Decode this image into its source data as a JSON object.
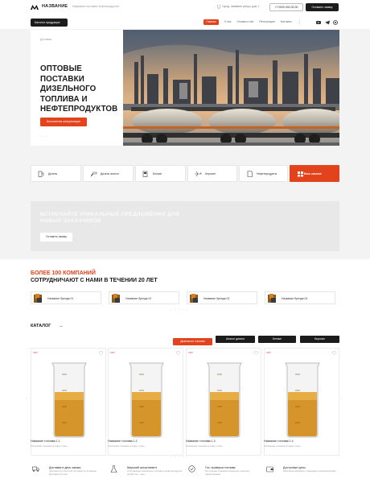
{
  "header": {
    "logo_text": "НАЗВАНИЕ",
    "tagline": "Надежная поставка нефтепродуктов",
    "city": "Город, название улицы, дом 1",
    "phone": "+7 0000 000-00-00",
    "order_btn": "Оставить заявку",
    "catalog_btn": "Каталог продукции",
    "nav": [
      "Главная",
      "О нас",
      "Отзывы о нас",
      "Контакты"
    ],
    "nav_extra": "Регистрация",
    "social": [
      "youtube-icon",
      "telegram-icon",
      "whatsapp-icon"
    ]
  },
  "hero": {
    "breadcrumb": "Доставка",
    "title": "ОПТОВЫЕ ПОСТАВКИ ДИЗЕЛЬНОГО ТОПЛИВА И НЕФТЕПРОДУКТОВ",
    "button": "Бесплатная консультация"
  },
  "categories": [
    {
      "label": "Дизель",
      "icon": "fuel-pump-icon"
    },
    {
      "label": "Дизель аналог",
      "icon": "fuel-nozzle-icon"
    },
    {
      "label": "Бензин",
      "icon": "gas-station-icon"
    },
    {
      "label": "Керосин",
      "icon": "plane-icon"
    },
    {
      "label": "Нефтепродукты",
      "icon": "document-icon"
    },
    {
      "label": "Весь каталог",
      "icon": "catalog-icon"
    }
  ],
  "banner": {
    "title": "ВСТРЕЧАЙТЕ УНИКАЛЬНЫЕ ПРЕДЛОЖЕНИЯ ДЛЯ НОВЫХ ЗАКАЗЧИКОВ",
    "button": "Оставить заявку"
  },
  "companies": {
    "title_line1": "БОЛЕЕ 100 КОМПАНИЙ",
    "title_line2": "СОТРУДНИЧАЮТ С НАМИ В ТЕЧЕНИИ 20 ЛЕТ",
    "brands": [
      "Название бренда 01",
      "Название бренда 02",
      "Название бренда 03",
      "Название бренда 04"
    ]
  },
  "catalog": {
    "title": "КАТАЛОГ",
    "tabs": [
      "Дизельное топливо",
      "Аналог дизеля",
      "Бензин",
      "Керосин"
    ],
    "products": [
      {
        "badge": "ХИТ",
        "name": "Название топлива 1.1",
        "desc": "Описание позиции в пару строк"
      },
      {
        "badge": "ХИТ",
        "name": "Название топлива 1.2",
        "desc": "Описание позиции в пару строк"
      },
      {
        "badge": "ХИТ",
        "name": "Название топлива 1.3",
        "desc": "Описание позиции в пару строк"
      },
      {
        "badge": "ХИТ",
        "name": "Название топлива 1.4",
        "desc": "Описание позиции в пару строк"
      }
    ]
  },
  "features": [
    {
      "title": "Доставка в день заказа",
      "desc": "Автопарк для быстрой поставки по 10 машин. Доставка 24 часа",
      "icon": "truck-icon"
    },
    {
      "title": "Широкий ассортимент",
      "desc": "Собственное хранилище топлива и нефтепродуктов на 200 тыс. тонн",
      "icon": "flask-icon"
    },
    {
      "title": "Гос. проверка топлива",
      "desc": "Регулярная проверка продукции, качество гарантировано",
      "icon": "certificate-icon"
    },
    {
      "title": "Доступные цены",
      "desc": "Работаем напрямую с заводами производителями",
      "icon": "wallet-icon"
    }
  ],
  "colors": {
    "accent": "#e2421c",
    "dark": "#1c1c1c"
  }
}
